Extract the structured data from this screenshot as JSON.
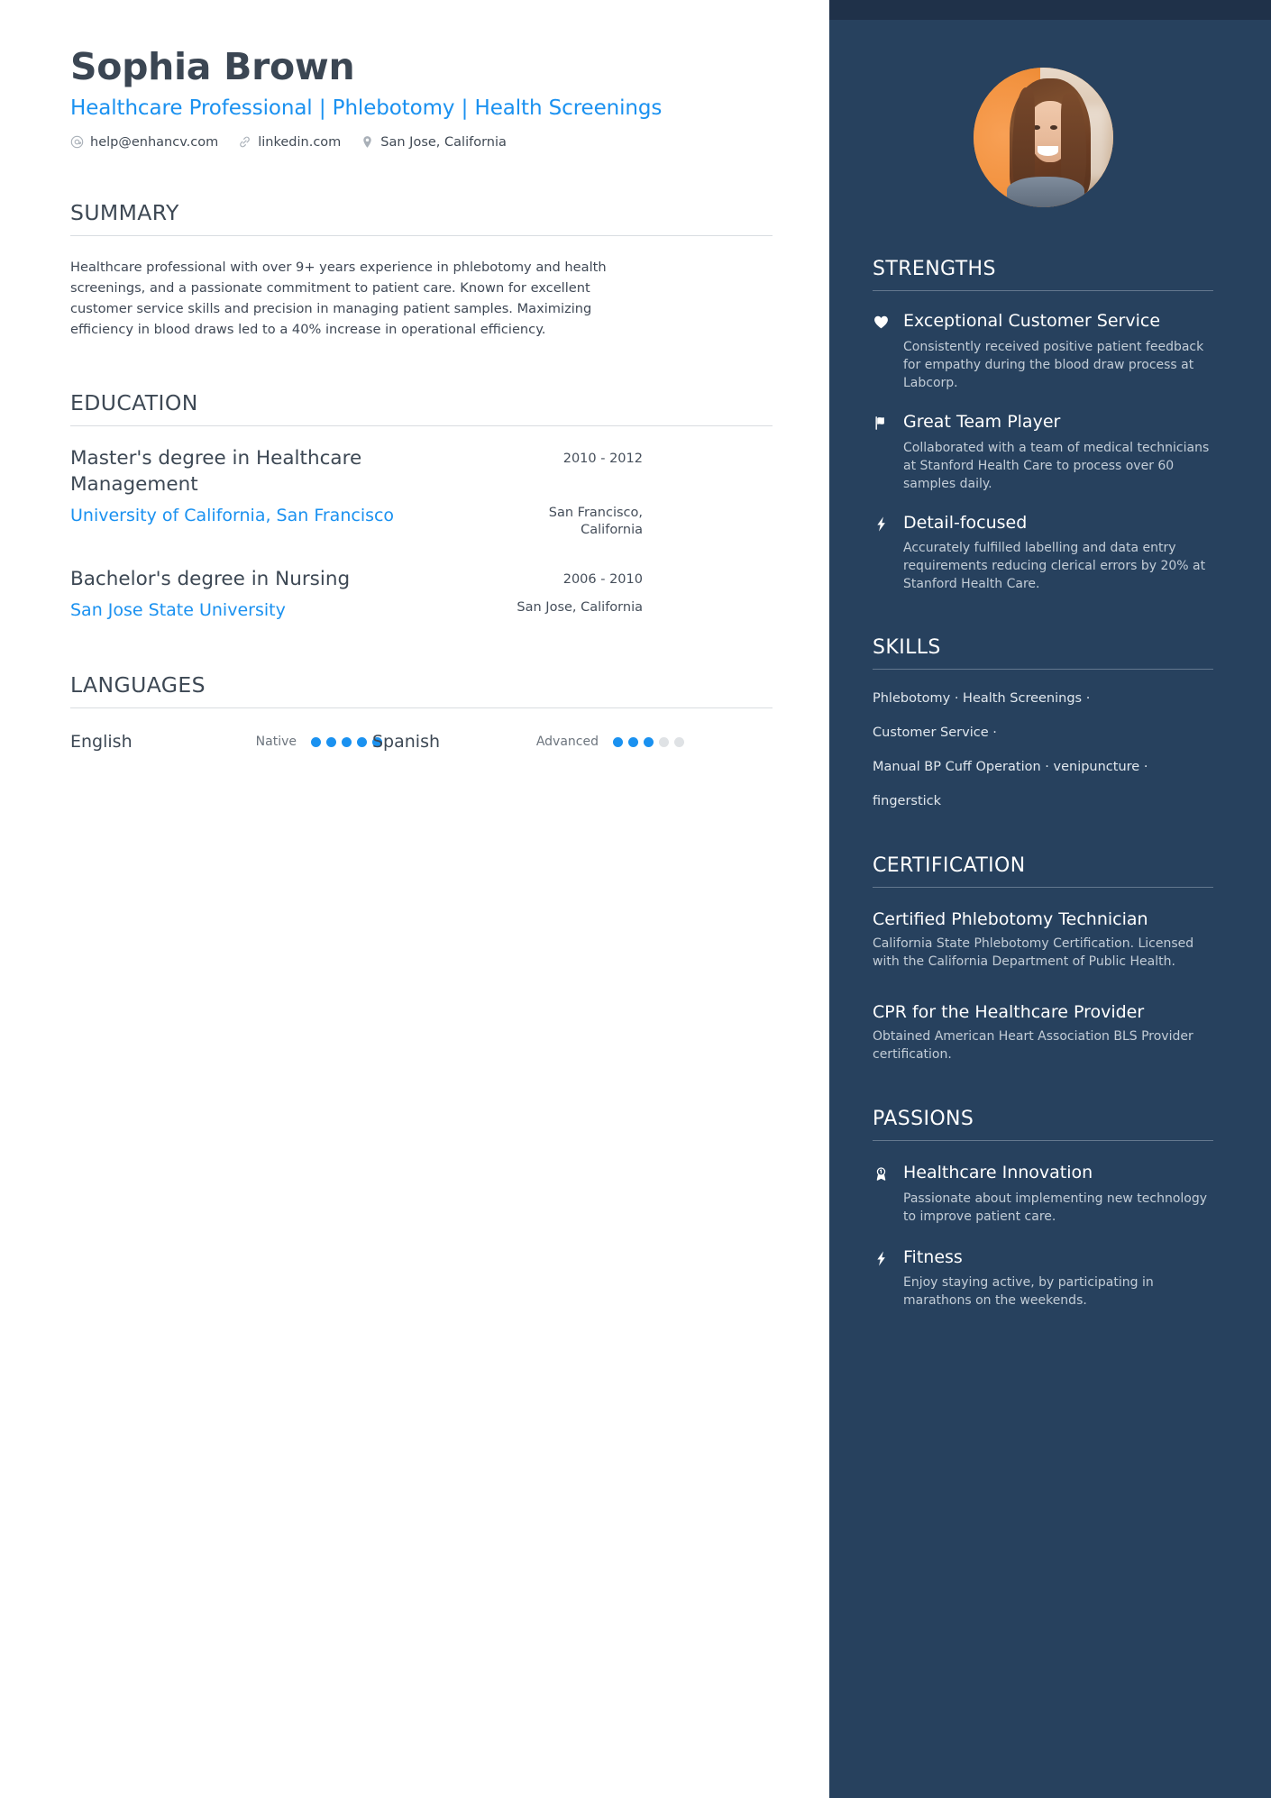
{
  "colors": {
    "accent_blue": "#1a91f0",
    "sidebar_bg": "#27415e",
    "sidebar_topbar": "#1f3149",
    "heading_dark": "#3d4854",
    "body_text": "#3f4855",
    "sidebar_muted": "#c3cdd7"
  },
  "header": {
    "name": "Sophia Brown",
    "headline": "Healthcare Professional | Phlebotomy | Health Screenings",
    "contacts": [
      {
        "icon": "at-sign-icon",
        "text": "help@enhancv.com"
      },
      {
        "icon": "link-icon",
        "text": "linkedin.com"
      },
      {
        "icon": "location-pin-icon",
        "text": "San Jose, California"
      }
    ],
    "avatar_alt": "profile-photo"
  },
  "summary": {
    "title": "SUMMARY",
    "text": "Healthcare professional with over 9+ years experience in phlebotomy and health screenings, and a passionate commitment to patient care. Known for excellent customer service skills and precision in managing patient samples. Maximizing efficiency in blood draws led to a 40% increase in operational efficiency."
  },
  "education": {
    "title": "EDUCATION",
    "items": [
      {
        "degree": "Master's degree in Healthcare Management",
        "school": "University of California, San Francisco",
        "date": "2010 - 2012",
        "location": "San Francisco, California"
      },
      {
        "degree": "Bachelor's degree in Nursing",
        "school": "San Jose State University",
        "date": "2006 - 2010",
        "location": "San Jose, California"
      }
    ]
  },
  "languages": {
    "title": "LANGUAGES",
    "items": [
      {
        "name": "English",
        "level": "Native",
        "filled": 5,
        "total": 5
      },
      {
        "name": "Spanish",
        "level": "Advanced",
        "filled": 3,
        "total": 5
      }
    ]
  },
  "strengths": {
    "title": "STRENGTHS",
    "items": [
      {
        "icon": "heart-icon",
        "title": "Exceptional Customer Service",
        "desc": "Consistently received positive patient feedback for empathy during the blood draw process at Labcorp."
      },
      {
        "icon": "flag-icon",
        "title": "Great Team Player",
        "desc": "Collaborated with a team of medical technicians at Stanford Health Care to process over 60 samples daily."
      },
      {
        "icon": "lightning-bolt-icon",
        "title": "Detail-focused",
        "desc": "Accurately fulfilled labelling and data entry requirements reducing clerical errors by 20% at Stanford Health Care."
      }
    ]
  },
  "skills": {
    "title": "SKILLS",
    "lines": [
      "Phlebotomy · Health Screenings ·",
      "Customer Service ·",
      "Manual BP Cuff Operation · venipuncture ·",
      "fingerstick"
    ]
  },
  "certification": {
    "title": "CERTIFICATION",
    "items": [
      {
        "title": "Certified Phlebotomy Technician",
        "desc": "California State Phlebotomy Certification. Licensed with the California Department of Public Health."
      },
      {
        "title": "CPR for the Healthcare Provider",
        "desc": "Obtained American Heart Association BLS Provider certification."
      }
    ]
  },
  "passions": {
    "title": "PASSIONS",
    "items": [
      {
        "icon": "award-medal-icon",
        "title": "Healthcare Innovation",
        "desc": "Passionate about implementing new technology to improve patient care."
      },
      {
        "icon": "lightning-bolt-icon",
        "title": "Fitness",
        "desc": "Enjoy staying active, by participating in marathons on the weekends."
      }
    ]
  }
}
